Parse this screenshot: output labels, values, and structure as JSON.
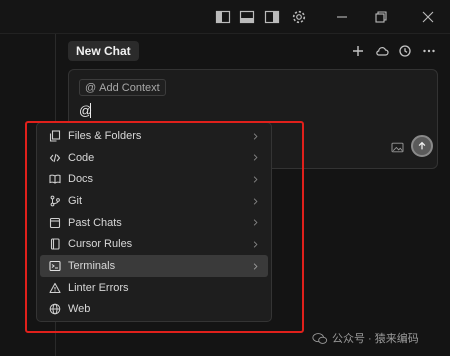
{
  "header": {
    "chat_tab_label": "New Chat"
  },
  "composer": {
    "context_chip_label": "Add Context",
    "context_chip_symbol": "@",
    "input_value": "@"
  },
  "mention_menu": {
    "items": [
      {
        "label": "Files & Folders",
        "icon": "files-icon",
        "has_submenu": true
      },
      {
        "label": "Code",
        "icon": "code-icon",
        "has_submenu": true
      },
      {
        "label": "Docs",
        "icon": "book-icon",
        "has_submenu": true
      },
      {
        "label": "Git",
        "icon": "git-icon",
        "has_submenu": true
      },
      {
        "label": "Past Chats",
        "icon": "chat-history-icon",
        "has_submenu": true
      },
      {
        "label": "Cursor Rules",
        "icon": "rules-icon",
        "has_submenu": true
      },
      {
        "label": "Terminals",
        "icon": "terminal-icon",
        "has_submenu": true,
        "active": true
      },
      {
        "label": "Linter Errors",
        "icon": "warning-icon",
        "has_submenu": false
      },
      {
        "label": "Web",
        "icon": "globe-icon",
        "has_submenu": false
      }
    ]
  },
  "watermark": {
    "text": "公众号 · 猿来编码"
  },
  "colors": {
    "background": "#141414",
    "menu_background": "#1e1e1e",
    "active_item": "#3a3a3a",
    "highlight_frame": "#e0201b"
  }
}
